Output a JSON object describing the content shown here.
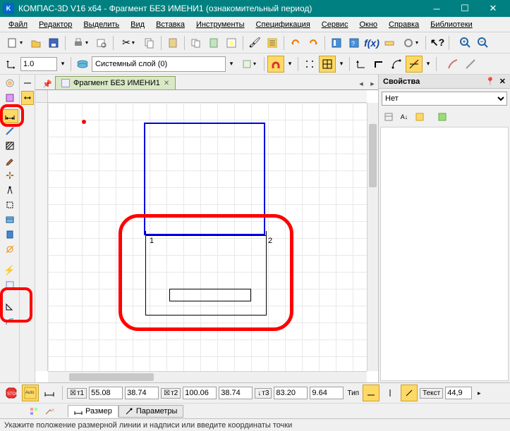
{
  "window": {
    "title": "КОМПАС-3D V16  x64 - Фрагмент БЕЗ ИМЕНИ1 (ознакомительный период)",
    "app_icon_label": "K"
  },
  "menu": {
    "file": "Файл",
    "editor": "Редактор",
    "selection": "Выделить",
    "view": "Вид",
    "insert": "Вставка",
    "tools": "Инструменты",
    "spec": "Спецификация",
    "service": "Сервис",
    "window": "Окно",
    "help": "Справка",
    "libs": "Библиотеки"
  },
  "toolbars": {
    "scale_value": "1.0",
    "layer_label": "Системный слой (0)",
    "fx_label": "f(x)"
  },
  "tabs": {
    "doc1": "Фрагмент БЕЗ ИМЕНИ1"
  },
  "drawing": {
    "p1": "1",
    "p2": "2"
  },
  "properties": {
    "title": "Свойства",
    "filter": "Нет"
  },
  "params": {
    "t1_label": "т1",
    "t1_x": "55.08",
    "t1_y": "38.74",
    "t2_label": "т2",
    "t2_x": "100.06",
    "t2_y": "38.74",
    "t3_label": "т3",
    "t3_x": "83.20",
    "t3_y": "9.64",
    "type_label": "Тип",
    "text_label": "Текст",
    "text_val": "44,9",
    "tab_size": "Размер",
    "tab_params": "Параметры"
  },
  "status": {
    "message": "Укажите положение размерной линии и надписи или введите координаты точки"
  }
}
